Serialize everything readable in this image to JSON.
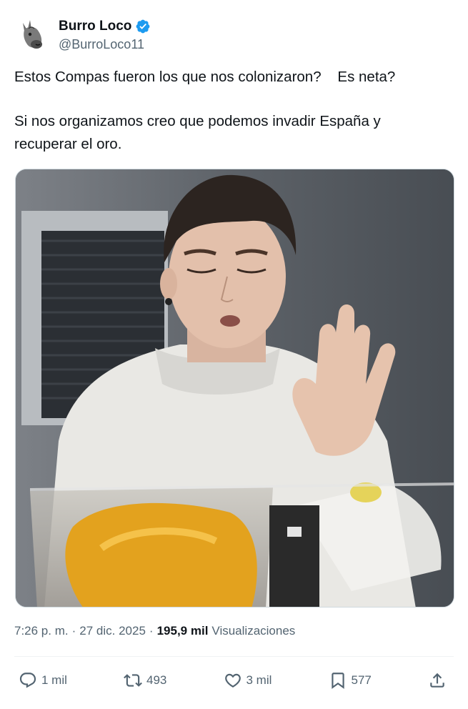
{
  "author": {
    "display_name": "Burro Loco",
    "handle": "@BurroLoco11",
    "verified": true,
    "verified_color": "#1d9bf0"
  },
  "tweet": {
    "line1": "Estos Compas fueron los que nos colonizaron?    Es neta?",
    "line2": "Si nos organizamos creo que podemos invadir España y",
    "line3": "recuperar el oro."
  },
  "meta": {
    "time": "7:26 p. m.",
    "separator": "·",
    "date": "27 dic. 2025",
    "views_count": "195,9 mil",
    "views_label": "Visualizaciones"
  },
  "actions": {
    "replies": "1 mil",
    "reposts": "493",
    "likes": "3 mil",
    "bookmarks": "577"
  },
  "icons": {
    "avatar": "donkey-avatar-icon",
    "verified": "verified-badge-icon",
    "reply": "reply-icon",
    "repost": "repost-icon",
    "like": "heart-icon",
    "bookmark": "bookmark-icon",
    "share": "share-icon"
  },
  "colors": {
    "text": "#0f1419",
    "secondary": "#536471",
    "border": "#eff3f4"
  }
}
